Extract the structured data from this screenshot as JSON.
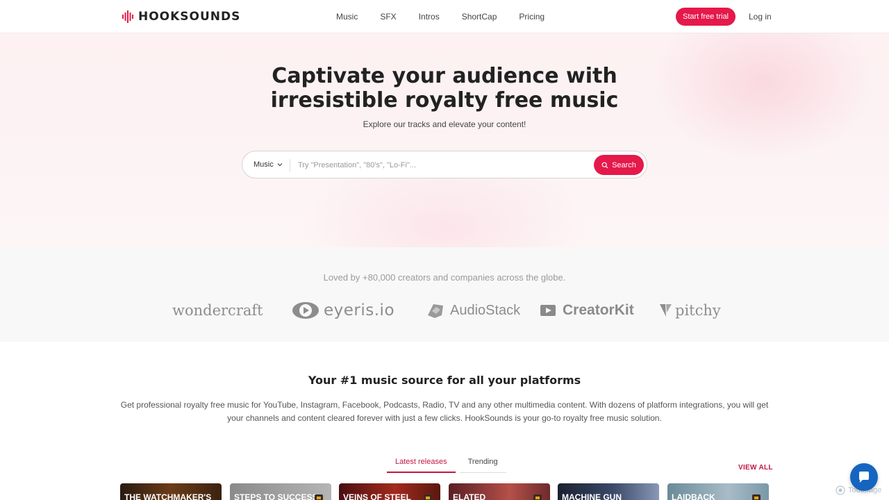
{
  "brand": {
    "name": "HOOKSOUNDS",
    "accent": "#e5194a"
  },
  "nav": {
    "links": [
      "Music",
      "SFX",
      "Intros",
      "ShortCap",
      "Pricing"
    ],
    "trial_label": "Start free trial",
    "login_label": "Log in"
  },
  "hero": {
    "title_line1": "Captivate your audience with",
    "title_line2": "irresistible royalty free music",
    "subtitle": "Explore our tracks and elevate your content!",
    "search": {
      "category": "Music",
      "placeholder": "Try \"Presentation\", \"80's\", \"Lo-Fi\"...",
      "button_label": "Search"
    }
  },
  "social_proof": {
    "text": "Loved by +80,000 creators and companies across the globe.",
    "logos": [
      "wondercraft",
      "eyeris.io",
      "AudioStack",
      "CreatorKit",
      "pitchy"
    ]
  },
  "platforms": {
    "title": "Your #1 music source for all your platforms",
    "description": "Get professional royalty free music for YouTube, Instagram, Facebook, Podcasts, Radio, TV and any other multimedia content. With dozens of platform integrations, you will get your channels and content cleared forever with just a few clicks. HookSounds is your go-to royalty free music solution."
  },
  "tracks": {
    "tabs": [
      "Latest releases",
      "Trending"
    ],
    "active_tab": "Latest releases",
    "view_all_label": "VIEW ALL",
    "cards": [
      {
        "title": "THE WATCHMAKER'S",
        "premium": false
      },
      {
        "title": "STEPS TO SUCCESS",
        "premium": true
      },
      {
        "title": "VEINS OF STEEL",
        "premium": true
      },
      {
        "title": "ELATED",
        "premium": true
      },
      {
        "title": "MACHINE GUN",
        "premium": false
      },
      {
        "title": "LAIDBACK",
        "premium": true
      }
    ]
  },
  "watermark": "TooImage"
}
